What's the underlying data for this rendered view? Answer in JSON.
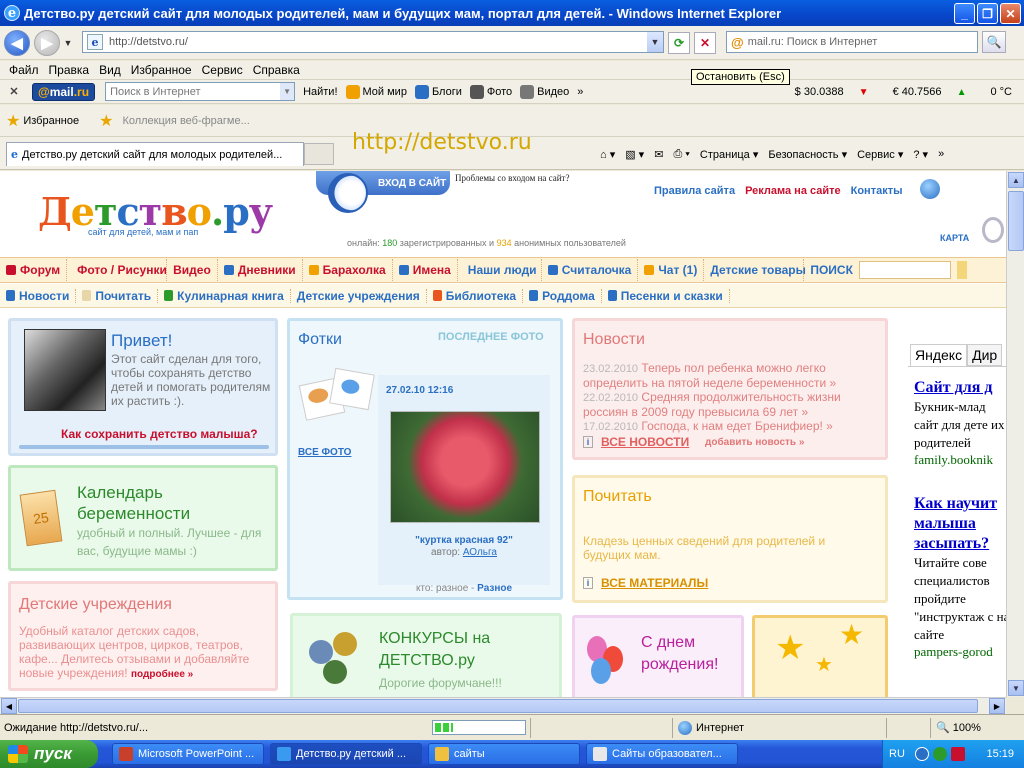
{
  "window": {
    "title": "Детство.ру детский сайт для молодых родителей, мам и будущих мам, портал для детей. - Windows Internet Explorer",
    "ie_glyph": "e",
    "min_glyph": "_",
    "max_glyph": "❐",
    "close_glyph": "✕"
  },
  "address": {
    "url": "http://detstvo.ru/",
    "search_placeholder": "mail.ru: Поиск в Интернет",
    "refresh_glyph": "⟳",
    "stop_glyph": "✕",
    "search_glyph": "🔍",
    "back_glyph": "◀",
    "fwd_glyph": "▶",
    "dd_glyph": "▼",
    "at_glyph": "@"
  },
  "menu": [
    "Файл",
    "Правка",
    "Вид",
    "Избранное",
    "Сервис",
    "Справка"
  ],
  "tooltip": "Остановить (Esc)",
  "mailbar": {
    "close": "✕",
    "logo_at": "@",
    "logo_mail": "mail",
    "logo_ru": ".ru",
    "search_placeholder": "Поиск в Интернет",
    "find": "Найти!",
    "items": [
      "Мой мир",
      "Блоги",
      "Фото",
      "Видео"
    ],
    "more": "»",
    "usd": "$ 30.0388",
    "eur": "€ 40.7566",
    "down_glyph": "▼",
    "up_glyph": "▲",
    "temp": "0 °C"
  },
  "favbar": {
    "favorites": "Избранное",
    "collection": "Коллекция веб-фрагме...",
    "star": "★"
  },
  "overlay_url": "http://detstvo.ru",
  "tab": {
    "label": "Детство.ру детский сайт для молодых родителей..."
  },
  "cmdbar": {
    "page": "Страница",
    "security": "Безопасность",
    "service": "Сервис",
    "help": "?",
    "more": "»"
  },
  "site": {
    "logo": [
      "Д",
      "е",
      "т",
      "с",
      "т",
      "в",
      "о",
      ".",
      "р",
      "у"
    ],
    "logo_sub": "сайт для детей, мам и пап",
    "login": "ВХОД В САЙТ",
    "problems": "Проблемы со входом на сайт?",
    "links": [
      "Правила сайта",
      "Реклама на сайте",
      "Контакты"
    ],
    "karta": "КАРТА",
    "online_label": "онлайн:",
    "online_reg": "180",
    "online_reg_txt": "зарегистрированных и",
    "online_anon": "934",
    "online_anon_txt": "анонимных пользователей",
    "nav1": [
      {
        "label": "Форум",
        "cls": "red",
        "color": "#c8102e"
      },
      {
        "label": "Фото / Рисунки",
        "cls": "red",
        "color": "#e8551e"
      },
      {
        "label": "Видео",
        "cls": "red",
        "color": "#c8102e"
      },
      {
        "label": "Дневники",
        "cls": "red",
        "color": "#2a6fc4"
      },
      {
        "label": "Барахолка",
        "cls": "red",
        "color": "#f0a000"
      },
      {
        "label": "Имена",
        "cls": "blue",
        "color": "#2a6fc4"
      },
      {
        "label": "Наши люди",
        "cls": "blue",
        "color": "#c8102e"
      },
      {
        "label": "Считалочка",
        "cls": "blue",
        "color": "#2a6fc4"
      },
      {
        "label": "Чат (1)",
        "cls": "blue",
        "color": "#f0a000"
      },
      {
        "label": "Детские товары",
        "cls": "blue",
        "color": "#fff"
      }
    ],
    "search_label": "ПОИСК",
    "nav2": [
      {
        "label": "Новости",
        "color": "#2a6fc4"
      },
      {
        "label": "Почитать",
        "color": "#e8d6a8"
      },
      {
        "label": "Кулинарная книга",
        "color": "#2c9b2c"
      },
      {
        "label": "Детские учреждения",
        "color": "#fff"
      },
      {
        "label": "Библиотека",
        "color": "#e8551e"
      },
      {
        "label": "Роддома",
        "color": "#2a6fc4"
      },
      {
        "label": "Песенки и сказки",
        "color": "#2a6fc4"
      }
    ],
    "hello": {
      "title": "Привет!",
      "text": "Этот сайт сделан для того, чтобы сохранять детство детей и помогать родителям их растить :).",
      "link": "Как сохранить детство малыша?"
    },
    "calendar": {
      "title": "Календарь беременности",
      "text": "удобный и полный. Лучшее - для вас, будущие мамы :)",
      "icon_num": "25"
    },
    "kids": {
      "title": "Детские учреждения",
      "text": "Удобный каталог детских садов, развивающих центров, цирков, театров, кафе... Делитесь отзывами и добавляйте новые учреждения!",
      "more": "подробнее »"
    },
    "photos": {
      "title": "Фотки",
      "last": "ПОСЛЕДНЕЕ ФОТО",
      "all": "ВСЕ ФОТО",
      "date": "27.02.10 12:16",
      "caption": "\"куртка красная 92\"",
      "author_label": "автор:",
      "author": "АОльга",
      "who_label": "кто: разное -",
      "who": "Разное"
    },
    "contest": {
      "title": "КОНКУРСЫ на ДЕТСТВО.ру",
      "text": "Дорогие форумчане!!!"
    },
    "news": {
      "title": "Новости",
      "items": [
        {
          "date": "23.02.2010",
          "text": "Теперь пол ребенка можно легко определить на пятой неделе беременности »"
        },
        {
          "date": "22.02.2010",
          "text": "Средняя продолжительность жизни россиян в 2009 году превысила 69 лет »"
        },
        {
          "date": "17.02.2010",
          "text": "Господа, к нам едет Бренифиер! »"
        }
      ],
      "all": "ВСЕ НОВОСТИ",
      "add": "добавить новость »"
    },
    "read": {
      "title": "Почитать",
      "text": "Кладезь ценных сведений для родителей и будущих мам.",
      "all": "ВСЕ МАТЕРИАЛЫ"
    },
    "bday": {
      "title": "С днем рождения!"
    },
    "yandex": {
      "tab1": "Яндекс",
      "tab2": "Дир",
      "ad1_head": "Сайт для д",
      "ad1_body": "Букник-млад сайт для дете их родителей",
      "ad1_url": "family.booknik",
      "ad2_head": "Как научит малыша засыпать?",
      "ad2_body": "Читайте сове специалистов пройдите \"инструктаж с на сайте",
      "ad2_url": "pampers-gorod"
    }
  },
  "status": {
    "text": "Ожидание http://detstvo.ru/...",
    "progress": 0.2,
    "zone": "Интернет",
    "zoom": "🔍 100%"
  },
  "taskbar": {
    "start": "пуск",
    "tasks": [
      {
        "label": "Microsoft PowerPoint ...",
        "color": "#c8402a"
      },
      {
        "label": "Детство.ру детский ...",
        "color": "#3a9af0"
      },
      {
        "label": "сайты",
        "color": "#f0c040"
      },
      {
        "label": "Сайты образовател...",
        "color": "#e8e8e8"
      }
    ],
    "lang": "RU",
    "clock": "15:19"
  }
}
